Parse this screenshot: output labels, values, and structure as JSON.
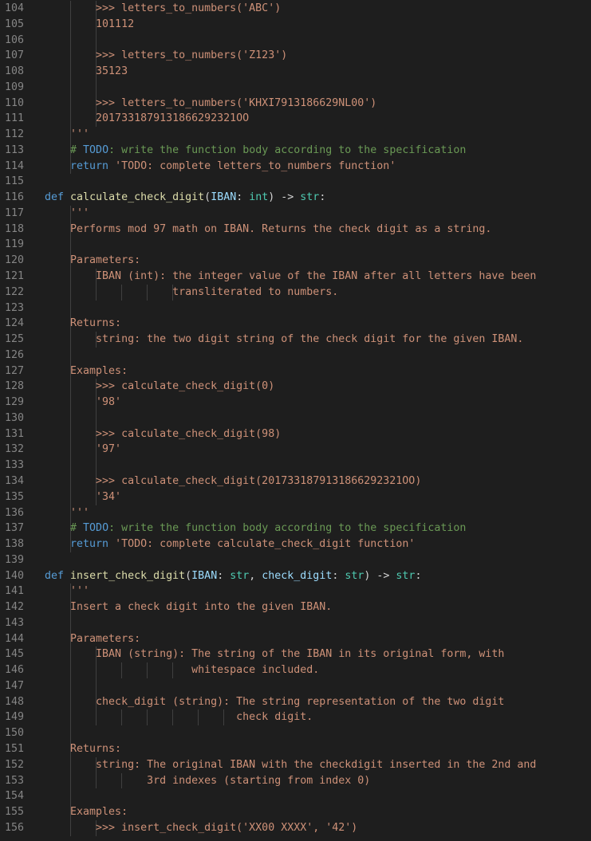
{
  "editor": {
    "lines": [
      {
        "n": "104",
        "g": [
          2,
          3
        ],
        "t": [
          {
            "x": "        >>> letters_to_numbers('ABC')",
            "c": "str"
          }
        ]
      },
      {
        "n": "105",
        "g": [
          2,
          3
        ],
        "t": [
          {
            "x": "        101112",
            "c": "str"
          }
        ]
      },
      {
        "n": "106",
        "g": [
          2,
          3
        ],
        "t": []
      },
      {
        "n": "107",
        "g": [
          2,
          3
        ],
        "t": [
          {
            "x": "        >>> letters_to_numbers('Z123')",
            "c": "str"
          }
        ]
      },
      {
        "n": "108",
        "g": [
          2,
          3
        ],
        "t": [
          {
            "x": "        35123",
            "c": "str"
          }
        ]
      },
      {
        "n": "109",
        "g": [
          2,
          3
        ],
        "t": []
      },
      {
        "n": "110",
        "g": [
          2,
          3
        ],
        "t": [
          {
            "x": "        >>> letters_to_numbers('KHXI7913186629NL00')",
            "c": "str"
          }
        ]
      },
      {
        "n": "111",
        "g": [
          2,
          3
        ],
        "t": [
          {
            "x": "        2017331879131866292321OO",
            "c": "str"
          }
        ]
      },
      {
        "n": "112",
        "g": [
          2
        ],
        "t": [
          {
            "x": "    '''",
            "c": "str"
          }
        ]
      },
      {
        "n": "113",
        "g": [
          2
        ],
        "t": [
          {
            "x": "    # ",
            "c": "cmt"
          },
          {
            "x": "TODO",
            "c": "todo"
          },
          {
            "x": ": write the function body according to the specification",
            "c": "cmt"
          }
        ]
      },
      {
        "n": "114",
        "g": [
          2
        ],
        "t": [
          {
            "x": "    ",
            "c": "punc"
          },
          {
            "x": "return",
            "c": "kw"
          },
          {
            "x": " 'TODO: complete letters_to_numbers function'",
            "c": "str"
          }
        ]
      },
      {
        "n": "115",
        "g": [],
        "t": []
      },
      {
        "n": "116",
        "g": [],
        "t": [
          {
            "x": "def",
            "c": "kw"
          },
          {
            "x": " ",
            "c": "punc"
          },
          {
            "x": "calculate_check_digit",
            "c": "fn"
          },
          {
            "x": "(",
            "c": "punc"
          },
          {
            "x": "IBAN",
            "c": "param"
          },
          {
            "x": ": ",
            "c": "punc"
          },
          {
            "x": "int",
            "c": "type"
          },
          {
            "x": ") -> ",
            "c": "punc"
          },
          {
            "x": "str",
            "c": "type"
          },
          {
            "x": ":",
            "c": "punc"
          }
        ]
      },
      {
        "n": "117",
        "g": [
          2
        ],
        "t": [
          {
            "x": "    '''",
            "c": "str"
          }
        ]
      },
      {
        "n": "118",
        "g": [
          2
        ],
        "t": [
          {
            "x": "    Performs mod 97 math on IBAN. Returns the check digit as a string.",
            "c": "str"
          }
        ]
      },
      {
        "n": "119",
        "g": [
          2
        ],
        "t": []
      },
      {
        "n": "120",
        "g": [
          2
        ],
        "t": [
          {
            "x": "    Parameters:",
            "c": "str"
          }
        ]
      },
      {
        "n": "121",
        "g": [
          2,
          3
        ],
        "t": [
          {
            "x": "        IBAN (int): the integer value of the IBAN after all letters have been",
            "c": "str"
          }
        ]
      },
      {
        "n": "122",
        "g": [
          2,
          3,
          4,
          5,
          6
        ],
        "t": [
          {
            "x": "                    transliterated to numbers.",
            "c": "str"
          }
        ]
      },
      {
        "n": "123",
        "g": [
          2
        ],
        "t": []
      },
      {
        "n": "124",
        "g": [
          2
        ],
        "t": [
          {
            "x": "    Returns:",
            "c": "str"
          }
        ]
      },
      {
        "n": "125",
        "g": [
          2,
          3
        ],
        "t": [
          {
            "x": "        string: the two digit string of the check digit for the given IBAN.",
            "c": "str"
          }
        ]
      },
      {
        "n": "126",
        "g": [
          2
        ],
        "t": []
      },
      {
        "n": "127",
        "g": [
          2
        ],
        "t": [
          {
            "x": "    Examples:",
            "c": "str"
          }
        ]
      },
      {
        "n": "128",
        "g": [
          2,
          3
        ],
        "t": [
          {
            "x": "        >>> calculate_check_digit(0)",
            "c": "str"
          }
        ]
      },
      {
        "n": "129",
        "g": [
          2,
          3
        ],
        "t": [
          {
            "x": "        '98'",
            "c": "str"
          }
        ]
      },
      {
        "n": "130",
        "g": [
          2,
          3
        ],
        "t": []
      },
      {
        "n": "131",
        "g": [
          2,
          3
        ],
        "t": [
          {
            "x": "        >>> calculate_check_digit(98)",
            "c": "str"
          }
        ]
      },
      {
        "n": "132",
        "g": [
          2,
          3
        ],
        "t": [
          {
            "x": "        '97'",
            "c": "str"
          }
        ]
      },
      {
        "n": "133",
        "g": [
          2,
          3
        ],
        "t": []
      },
      {
        "n": "134",
        "g": [
          2,
          3
        ],
        "t": [
          {
            "x": "        >>> calculate_check_digit(2017331879131866292321OO)",
            "c": "str"
          }
        ]
      },
      {
        "n": "135",
        "g": [
          2,
          3
        ],
        "t": [
          {
            "x": "        '34'",
            "c": "str"
          }
        ]
      },
      {
        "n": "136",
        "g": [
          2
        ],
        "t": [
          {
            "x": "    '''",
            "c": "str"
          }
        ]
      },
      {
        "n": "137",
        "g": [
          2
        ],
        "t": [
          {
            "x": "    # ",
            "c": "cmt"
          },
          {
            "x": "TODO",
            "c": "todo"
          },
          {
            "x": ": write the function body according to the specification",
            "c": "cmt"
          }
        ]
      },
      {
        "n": "138",
        "g": [
          2
        ],
        "t": [
          {
            "x": "    ",
            "c": "punc"
          },
          {
            "x": "return",
            "c": "kw"
          },
          {
            "x": " 'TODO: complete calculate_check_digit function'",
            "c": "str"
          }
        ]
      },
      {
        "n": "139",
        "g": [],
        "t": []
      },
      {
        "n": "140",
        "g": [],
        "t": [
          {
            "x": "def",
            "c": "kw"
          },
          {
            "x": " ",
            "c": "punc"
          },
          {
            "x": "insert_check_digit",
            "c": "fn"
          },
          {
            "x": "(",
            "c": "punc"
          },
          {
            "x": "IBAN",
            "c": "param"
          },
          {
            "x": ": ",
            "c": "punc"
          },
          {
            "x": "str",
            "c": "type"
          },
          {
            "x": ", ",
            "c": "punc"
          },
          {
            "x": "check_digit",
            "c": "param"
          },
          {
            "x": ": ",
            "c": "punc"
          },
          {
            "x": "str",
            "c": "type"
          },
          {
            "x": ") -> ",
            "c": "punc"
          },
          {
            "x": "str",
            "c": "type"
          },
          {
            "x": ":",
            "c": "punc"
          }
        ]
      },
      {
        "n": "141",
        "g": [
          2
        ],
        "t": [
          {
            "x": "    '''",
            "c": "str"
          }
        ]
      },
      {
        "n": "142",
        "g": [
          2
        ],
        "t": [
          {
            "x": "    Insert a check digit into the given IBAN.",
            "c": "str"
          }
        ]
      },
      {
        "n": "143",
        "g": [
          2
        ],
        "t": []
      },
      {
        "n": "144",
        "g": [
          2
        ],
        "t": [
          {
            "x": "    Parameters:",
            "c": "str"
          }
        ]
      },
      {
        "n": "145",
        "g": [
          2,
          3
        ],
        "t": [
          {
            "x": "        IBAN (string): The string of the IBAN in its original form, with",
            "c": "str"
          }
        ]
      },
      {
        "n": "146",
        "g": [
          2,
          3,
          4,
          5,
          6
        ],
        "t": [
          {
            "x": "                       whitespace included.",
            "c": "str"
          }
        ]
      },
      {
        "n": "147",
        "g": [
          2,
          3
        ],
        "t": []
      },
      {
        "n": "148",
        "g": [
          2,
          3
        ],
        "t": [
          {
            "x": "        check_digit (string): The string representation of the two digit",
            "c": "str"
          }
        ]
      },
      {
        "n": "149",
        "g": [
          2,
          3,
          4,
          5,
          6,
          7,
          8
        ],
        "t": [
          {
            "x": "                              check digit.",
            "c": "str"
          }
        ]
      },
      {
        "n": "150",
        "g": [
          2
        ],
        "t": []
      },
      {
        "n": "151",
        "g": [
          2
        ],
        "t": [
          {
            "x": "    Returns:",
            "c": "str"
          }
        ]
      },
      {
        "n": "152",
        "g": [
          2,
          3
        ],
        "t": [
          {
            "x": "        string: The original IBAN with the checkdigit inserted in the 2nd and",
            "c": "str"
          }
        ]
      },
      {
        "n": "153",
        "g": [
          2,
          3,
          4
        ],
        "t": [
          {
            "x": "                3rd indexes (starting from index 0)",
            "c": "str"
          }
        ]
      },
      {
        "n": "154",
        "g": [
          2
        ],
        "t": []
      },
      {
        "n": "155",
        "g": [
          2
        ],
        "t": [
          {
            "x": "    Examples:",
            "c": "str"
          }
        ]
      },
      {
        "n": "156",
        "g": [
          2,
          3
        ],
        "t": [
          {
            "x": "        >>> insert_check_digit('XX00 XXXX', '42')",
            "c": "str"
          }
        ]
      }
    ]
  }
}
